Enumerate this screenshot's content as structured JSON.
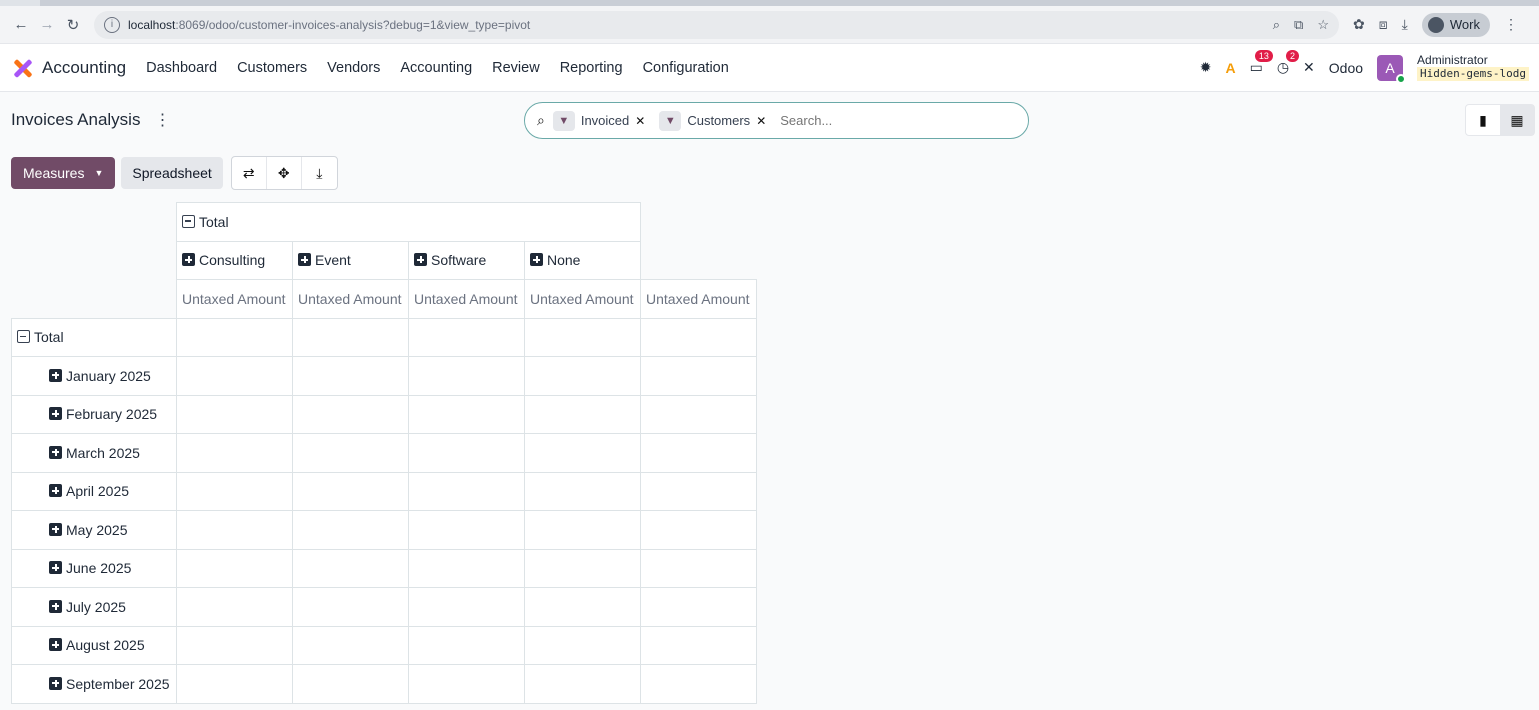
{
  "browser": {
    "url_host": "localhost",
    "url_path": ":8069/odoo/customer-invoices-analysis?debug=1&view_type=pivot",
    "profile_label": "Work"
  },
  "navbar": {
    "app_name": "Accounting",
    "menu": [
      "Dashboard",
      "Customers",
      "Vendors",
      "Accounting",
      "Review",
      "Reporting",
      "Configuration"
    ],
    "messages_count": "13",
    "activities_count": "2",
    "company": "Odoo",
    "avatar_letter": "A",
    "user_name": "Administrator",
    "db_name": "Hidden-gems-lodg"
  },
  "control": {
    "title": "Invoices Analysis",
    "facets": [
      {
        "label": "Invoiced"
      },
      {
        "label": "Customers"
      }
    ],
    "search_placeholder": "Search..."
  },
  "toolbar": {
    "measures_label": "Measures",
    "spreadsheet_label": "Spreadsheet"
  },
  "pivot": {
    "col_total_label": "Total",
    "col_groups": [
      "Consulting",
      "Event",
      "Software",
      "None"
    ],
    "measure_label": "Untaxed Amount",
    "row_total_label": "Total",
    "rows": [
      "January 2025",
      "February 2025",
      "March 2025",
      "April 2025",
      "May 2025",
      "June 2025",
      "July 2025",
      "August 2025",
      "September 2025"
    ]
  },
  "colors": {
    "primary": "#714b67",
    "search_border": "#6aa9a8"
  }
}
